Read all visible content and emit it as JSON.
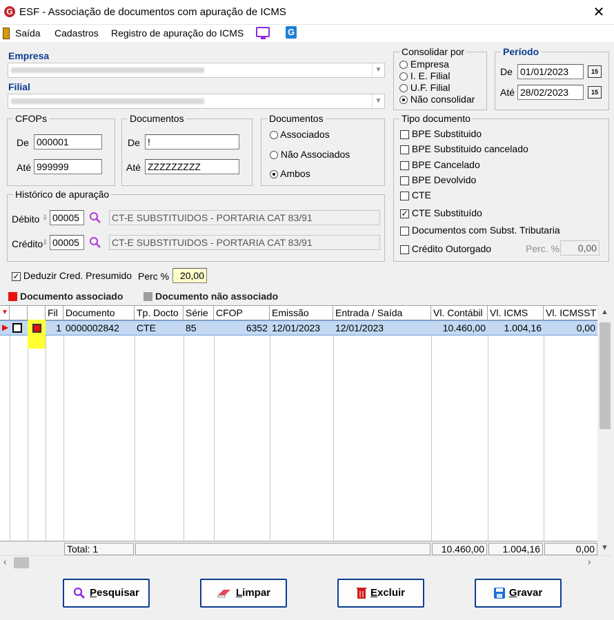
{
  "window": {
    "title": "ESF - Associação de documentos com apuração de ICMS",
    "close_label": "✕"
  },
  "menu": {
    "items": [
      "Saída",
      "Cadastros",
      "Registro de apuração do ICMS"
    ]
  },
  "empresa": {
    "label": "Empresa",
    "value": "999 GRANELEIRO TRANSP. RODOV. LTDA"
  },
  "filial": {
    "label": "Filial",
    "value": "999 GRANELEIRO TRANSP. RODOV. LTDA"
  },
  "consolidar": {
    "label": "Consolidar por",
    "options": [
      "Empresa",
      "I. E. Filial",
      "U.F. Filial",
      "Não consolidar"
    ],
    "selected": "Não consolidar"
  },
  "periodo": {
    "label": "Período",
    "de_label": "De",
    "de_value": "01/01/2023",
    "ate_label": "Até",
    "ate_value": "28/02/2023",
    "cal_label": "15"
  },
  "cfops": {
    "label": "CFOPs",
    "de_label": "De",
    "de_value": "000001",
    "ate_label": "Até",
    "ate_value": "999999"
  },
  "documentos_range": {
    "label": "Documentos",
    "de_label": "De",
    "de_value": "!",
    "ate_label": "Até",
    "ate_value": "ZZZZZZZZZ"
  },
  "documentos_filter": {
    "label": "Documentos",
    "options": [
      "Associados",
      "Não Associados",
      "Ambos"
    ],
    "selected": "Ambos"
  },
  "tipo_documento": {
    "label": "Tipo documento",
    "items": [
      {
        "label": "BPE Substituido",
        "checked": false
      },
      {
        "label": "BPE Substituido cancelado",
        "checked": false
      },
      {
        "label": "BPE Cancelado",
        "checked": false
      },
      {
        "label": "BPE Devolvido",
        "checked": false
      },
      {
        "label": "CTE",
        "checked": false
      },
      {
        "label": "CTE Substituído",
        "checked": true
      },
      {
        "label": "Documentos com Subst. Tributaria",
        "checked": false
      },
      {
        "label": "Crédito Outorgado",
        "checked": false
      }
    ],
    "perc_label": "Perc. %",
    "perc_value": "0,00"
  },
  "historico": {
    "label": "Histórico de apuração",
    "debito_label": "Débito",
    "debito_code": "00005",
    "debito_desc": "CT-E SUBSTITUIDOS -   PORTARIA CAT 83/91",
    "credito_label": "Crédito",
    "credito_code": "00005",
    "credito_desc": "CT-E SUBSTITUIDOS -   PORTARIA CAT 83/91"
  },
  "deduzir": {
    "label": "Deduzir Cred. Presumido",
    "checked": true,
    "perc_label": "Perc %",
    "perc_value": "20,00"
  },
  "legend": {
    "associado": "Documento associado",
    "nao_associado": "Documento não associado",
    "associado_color": "#e81010",
    "nao_associado_color": "#9e9e9e"
  },
  "grid": {
    "columns": [
      "Fil",
      "Documento",
      "Tp. Docto",
      "Série",
      "CFOP",
      "Emissão",
      "Entrada / Saída",
      "Vl. Contábil",
      "Vl. ICMS",
      "Vl. ICMSST"
    ],
    "rows": [
      {
        "fil": "1",
        "documento": "0000002842",
        "tp_docto": "CTE",
        "serie": "85",
        "cfop": "6352",
        "emissao": "12/01/2023",
        "entrada_saida": "12/01/2023",
        "vl_contabil": "10.460,00",
        "vl_icms": "1.004,16",
        "vl_icmsst": "0,00"
      }
    ],
    "totals": {
      "label": "Total: 1",
      "vl_contabil": "10.460,00",
      "vl_icms": "1.004,16",
      "vl_icmsst": "0,00"
    }
  },
  "buttons": {
    "pesquisar": {
      "hotkey": "P",
      "rest": "esquisar"
    },
    "limpar": {
      "hotkey": "L",
      "rest": "impar"
    },
    "excluir": {
      "hotkey": "E",
      "rest": "xcluir"
    },
    "gravar": {
      "hotkey": "G",
      "rest": "ravar"
    }
  }
}
